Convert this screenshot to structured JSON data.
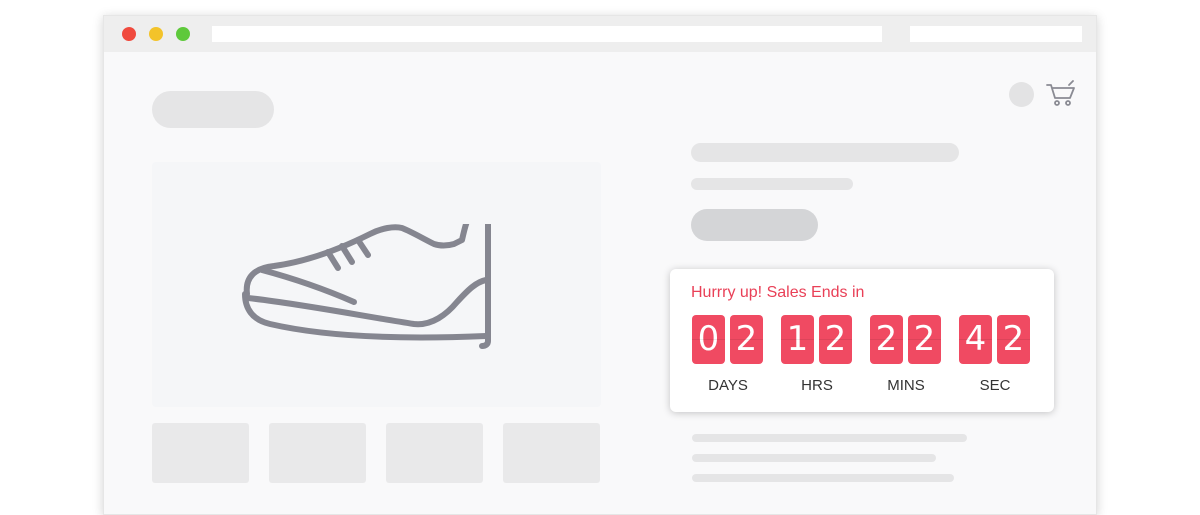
{
  "countdown": {
    "heading": "Hurrry up! Sales Ends in",
    "accent_color": "#f04a62",
    "heading_color": "#e94057",
    "units": [
      {
        "label": "DAYS",
        "digits": [
          "0",
          "2"
        ]
      },
      {
        "label": "HRS",
        "digits": [
          "1",
          "2"
        ]
      },
      {
        "label": "MINS",
        "digits": [
          "2",
          "2"
        ]
      },
      {
        "label": "SEC",
        "digits": [
          "4",
          "2"
        ]
      }
    ]
  },
  "icons": {
    "product": "sneaker-icon",
    "cart": "shopping-cart-icon",
    "account": "avatar"
  },
  "window_controls": {
    "close_color": "#f04a3e",
    "minimize_color": "#f3c32a",
    "maximize_color": "#5ec93b"
  }
}
